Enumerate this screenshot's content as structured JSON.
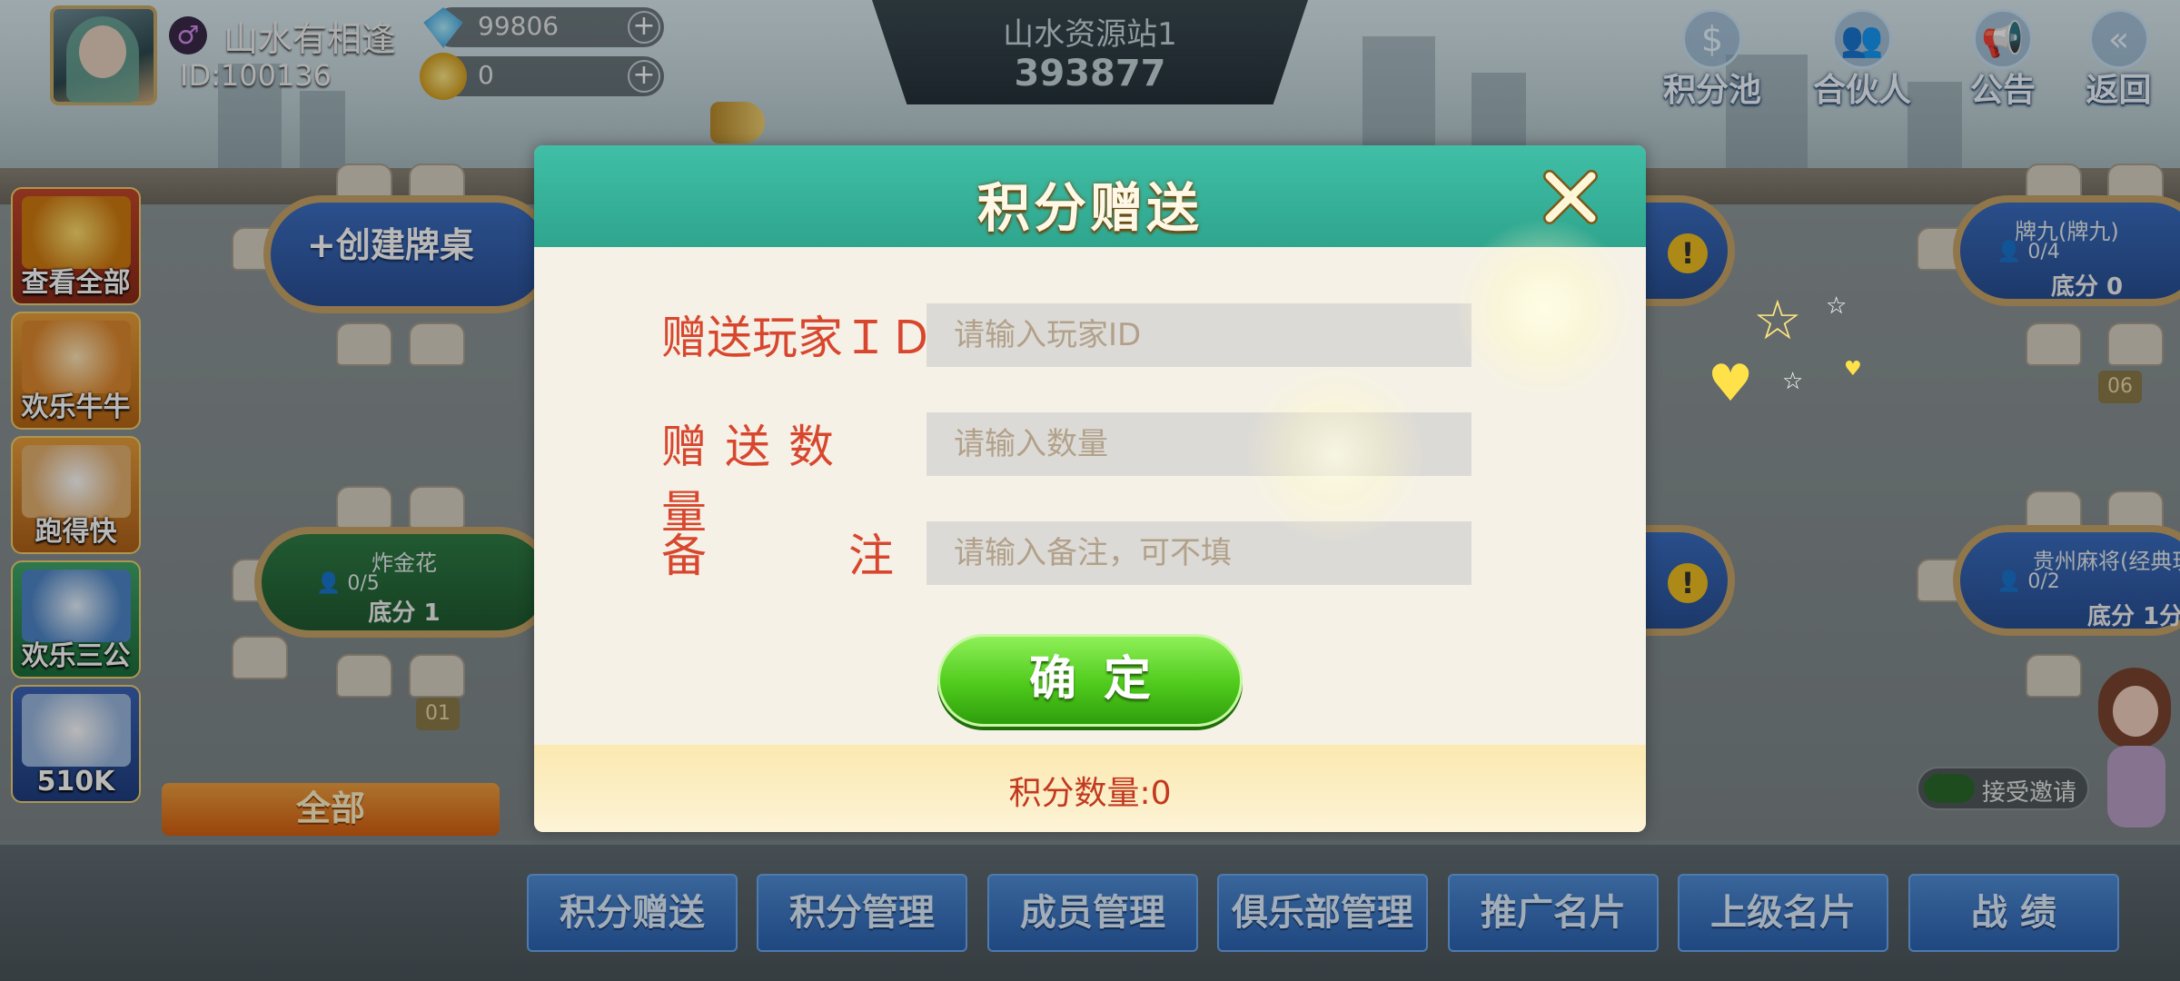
{
  "profile": {
    "nickname": "山水有相逢",
    "id_text": "ID:100136",
    "gender_icon": "male-symbol-icon",
    "diamonds": "99806",
    "gold": "0"
  },
  "club": {
    "name": "山水资源站1",
    "code": "393877"
  },
  "top_right": [
    {
      "label": "积分池",
      "icon": "points-pool-icon"
    },
    {
      "label": "合伙人",
      "icon": "partners-icon"
    },
    {
      "label": "公告",
      "icon": "megaphone-icon"
    },
    {
      "label": "返回",
      "icon": "back-arrow-icon"
    }
  ],
  "left_games": [
    {
      "label": "查看全部"
    },
    {
      "label": "欢乐牛牛"
    },
    {
      "label": "跑得快"
    },
    {
      "label": "欢乐三公"
    },
    {
      "label": "510K"
    }
  ],
  "filter_all": "全部",
  "tables": {
    "create": "+创建牌桌",
    "zjh": {
      "name": "炸金花",
      "seats": "0/5",
      "base": "底分 1",
      "num": "01"
    },
    "pj": {
      "name": "牌九(牌九)",
      "seats": "0/4",
      "base": "底分 0",
      "num": "06"
    },
    "gz": {
      "name": "贵州麻将(经典玩",
      "seats": "0/2",
      "base": "底分 1分"
    }
  },
  "bottom_tabs": [
    "积分赠送",
    "积分管理",
    "成员管理",
    "俱乐部管理",
    "推广名片",
    "上级名片",
    "战 绩"
  ],
  "invite_label": "接受邀请",
  "modal": {
    "title": "积分赠送",
    "player_id_label": "赠送玩家ＩＤ",
    "player_id_placeholder": "请输入玩家ID",
    "amount_label": "赠送数量",
    "amount_placeholder": "请输入数量",
    "remark_label_1": "备",
    "remark_label_2": "注",
    "remark_placeholder": "请输入备注，可不填",
    "confirm": "确定",
    "points_text": "积分数量:0"
  },
  "colors": {
    "modal_header": "#37b29b",
    "label_red": "#d8462e",
    "confirm_green": "#4fca1c",
    "tab_blue": "#3a78c8"
  }
}
